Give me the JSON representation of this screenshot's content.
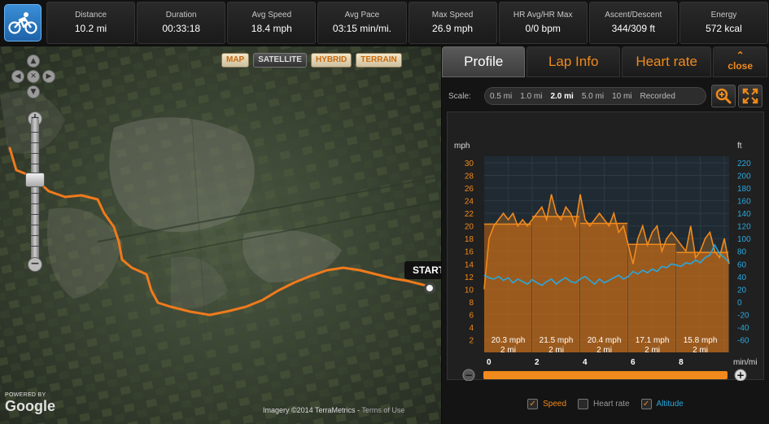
{
  "app": {
    "icon": "cyclist-icon"
  },
  "stats": [
    {
      "label": "Distance",
      "value": "10.2 mi"
    },
    {
      "label": "Duration",
      "value": "00:33:18"
    },
    {
      "label": "Avg Speed",
      "value": "18.4 mph"
    },
    {
      "label": "Avg Pace",
      "value": "03:15 min/mi."
    },
    {
      "label": "Max Speed",
      "value": "26.9 mph"
    },
    {
      "label": "HR Avg/HR Max",
      "value": "0/0 bpm"
    },
    {
      "label": "Ascent/Descent",
      "value": "344/309 ft"
    },
    {
      "label": "Energy",
      "value": "572 kcal"
    }
  ],
  "map": {
    "types": [
      "MAP",
      "SATELLITE",
      "HYBRID",
      "TERRAIN"
    ],
    "selected_type": "SATELLITE",
    "start_label": "START",
    "powered_by": "POWERED BY",
    "google": "Google",
    "imagery": "Imagery ©2014  TerraMetrics",
    "terms": "Terms of Use",
    "route_color": "#f07a1c"
  },
  "panel": {
    "tabs": [
      "Profile",
      "Lap Info",
      "Heart rate"
    ],
    "active_tab": "Profile",
    "close_chevron": "⌃",
    "close_label": "close",
    "scale_label": "Scale:",
    "scale_options": [
      "0.5 mi",
      "1.0 mi",
      "2.0 mi",
      "5.0 mi",
      "10 mi",
      "Recorded"
    ],
    "scale_selected": "2.0 mi",
    "legend": [
      {
        "label": "Speed",
        "checked": true,
        "color": "#f08a1c"
      },
      {
        "label": "Heart rate",
        "checked": false,
        "color": "#9a9a9a"
      },
      {
        "label": "Altitude",
        "checked": true,
        "color": "#2aa7dd"
      }
    ]
  },
  "chart_data": {
    "type": "area",
    "y_left_unit": "mph",
    "y_right_unit": "ft",
    "x_unit": "min/mi",
    "y_left_ticks": [
      2,
      4,
      6,
      8,
      10,
      12,
      14,
      16,
      18,
      20,
      22,
      24,
      26,
      28,
      30
    ],
    "y_right_ticks": [
      -60,
      -40,
      -20,
      0,
      20,
      40,
      60,
      80,
      100,
      120,
      140,
      160,
      180,
      200,
      220
    ],
    "x_ticks": [
      0,
      2,
      4,
      6,
      8
    ],
    "ylim_left": [
      0,
      30
    ],
    "ylim_right": [
      -80,
      220
    ],
    "xlim": [
      0,
      10.2
    ],
    "laps": [
      {
        "start": 0,
        "end": 2,
        "speed": 20.3,
        "speed_label": "20.3 mph",
        "dist_label": "2 mi"
      },
      {
        "start": 2,
        "end": 4,
        "speed": 21.5,
        "speed_label": "21.5 mph",
        "dist_label": "2 mi"
      },
      {
        "start": 4,
        "end": 6,
        "speed": 20.4,
        "speed_label": "20.4 mph",
        "dist_label": "2 mi"
      },
      {
        "start": 6,
        "end": 8,
        "speed": 17.1,
        "speed_label": "17.1 mph",
        "dist_label": "2 mi"
      },
      {
        "start": 8,
        "end": 10.2,
        "speed": 15.8,
        "speed_label": "15.8 mph",
        "dist_label": "2 mi"
      }
    ],
    "speed": {
      "x": [
        0,
        0.2,
        0.4,
        0.6,
        0.8,
        1.0,
        1.2,
        1.4,
        1.6,
        1.8,
        2.0,
        2.2,
        2.4,
        2.6,
        2.8,
        3.0,
        3.2,
        3.4,
        3.6,
        3.8,
        4.0,
        4.2,
        4.4,
        4.6,
        4.8,
        5.0,
        5.2,
        5.4,
        5.6,
        5.8,
        6.0,
        6.2,
        6.4,
        6.6,
        6.8,
        7.0,
        7.2,
        7.4,
        7.6,
        7.8,
        8.0,
        8.2,
        8.4,
        8.6,
        8.8,
        9.0,
        9.2,
        9.4,
        9.6,
        9.8,
        10.0,
        10.2
      ],
      "y": [
        10,
        18,
        20,
        21,
        22,
        21,
        22,
        20,
        21,
        20,
        21,
        22,
        23,
        21,
        25,
        22,
        21,
        23,
        22,
        20,
        25,
        21,
        20,
        21,
        22,
        21,
        20,
        22,
        19,
        20,
        17,
        14,
        18,
        20,
        17,
        19,
        20,
        16,
        18,
        19,
        18,
        17,
        16,
        20,
        15,
        16,
        18,
        19,
        16,
        15,
        18,
        14
      ]
    },
    "altitude": {
      "x": [
        0,
        0.2,
        0.4,
        0.6,
        0.8,
        1.0,
        1.2,
        1.4,
        1.6,
        1.8,
        2.0,
        2.2,
        2.4,
        2.6,
        2.8,
        3.0,
        3.2,
        3.4,
        3.6,
        3.8,
        4.0,
        4.2,
        4.4,
        4.6,
        4.8,
        5.0,
        5.2,
        5.4,
        5.6,
        5.8,
        6.0,
        6.2,
        6.4,
        6.6,
        6.8,
        7.0,
        7.2,
        7.4,
        7.6,
        7.8,
        8.0,
        8.2,
        8.4,
        8.6,
        8.8,
        9.0,
        9.2,
        9.4,
        9.6,
        9.8,
        10.0,
        10.2
      ],
      "y": [
        42,
        38,
        36,
        40,
        34,
        38,
        30,
        36,
        32,
        28,
        35,
        30,
        26,
        32,
        36,
        28,
        34,
        38,
        32,
        30,
        36,
        40,
        34,
        28,
        36,
        30,
        34,
        38,
        42,
        36,
        40,
        48,
        44,
        50,
        46,
        52,
        48,
        56,
        54,
        60,
        58,
        56,
        62,
        60,
        66,
        62,
        70,
        74,
        90,
        76,
        70,
        62
      ]
    }
  }
}
